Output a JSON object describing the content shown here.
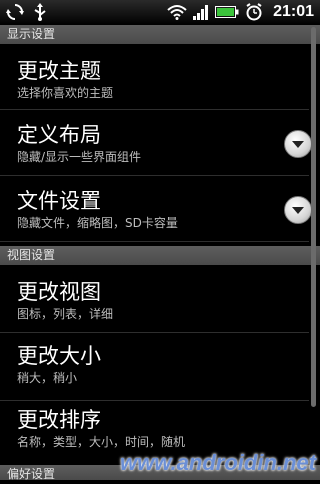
{
  "status_bar": {
    "time": "21:01",
    "icons": [
      "sync-icon",
      "usb-icon",
      "wifi-icon",
      "signal-icon",
      "battery-icon",
      "alarm-icon"
    ]
  },
  "sections": {
    "display": "显示设置",
    "view": "视图设置",
    "preference": "偏好设置"
  },
  "items": {
    "theme": {
      "title": "更改主题",
      "subtitle": "选择你喜欢的主题"
    },
    "layout": {
      "title": "定义布局",
      "subtitle": "隐藏/显示一些界面组件"
    },
    "file": {
      "title": "文件设置",
      "subtitle": "隐藏文件，缩略图，SD卡容量"
    },
    "view": {
      "title": "更改视图",
      "subtitle": "图标，列表，详细"
    },
    "size": {
      "title": "更改大小",
      "subtitle": "稍大，稍小"
    },
    "sort": {
      "title": "更改排序",
      "subtitle": "名称，类型，大小，时间，随机"
    }
  },
  "watermark": "www.androidin.net",
  "colors": {
    "background": "#000000",
    "section_header": "#555555",
    "watermark": "#6b8fd6"
  }
}
